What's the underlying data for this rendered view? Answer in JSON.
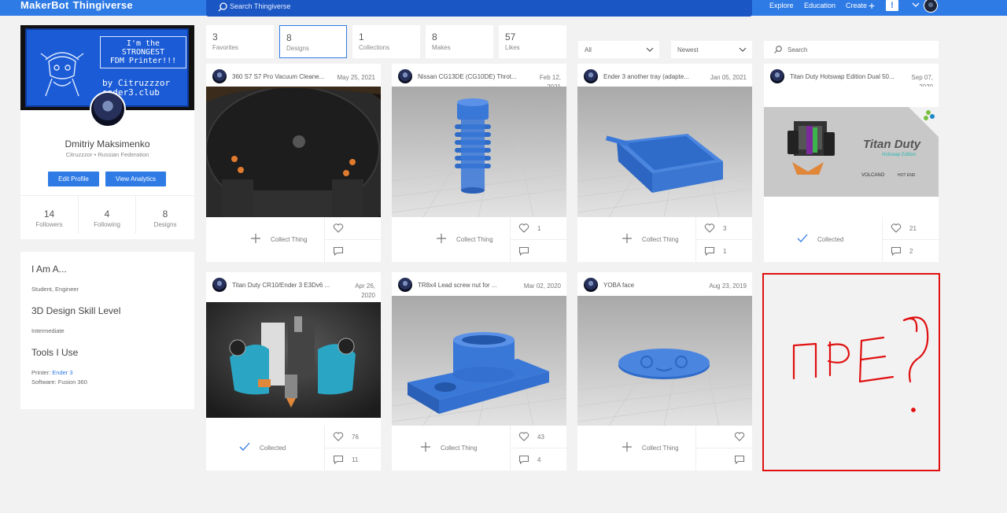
{
  "header": {
    "logo_part1": "MakerBot",
    "logo_part2": "Thingiverse",
    "search_placeholder": "Search Thingiverse",
    "nav": {
      "explore": "Explore",
      "education": "Education",
      "create": "Create",
      "alert": "!"
    }
  },
  "profile": {
    "cover_text": "I'm the\nSTRONGEST\nFDM Printer!!!",
    "cover_text2": "by Citruzzzor\nender3.club",
    "name": "Dmitriy Maksimenko",
    "subtitle": "Citruzzzor • Russian Federation",
    "edit_label": "Edit Profile",
    "analytics_label": "View Analytics",
    "stats": [
      {
        "n": "14",
        "l": "Followers"
      },
      {
        "n": "4",
        "l": "Following"
      },
      {
        "n": "8",
        "l": "Designs"
      }
    ]
  },
  "about": {
    "h1": "I Am A...",
    "t1": "Student,  Engineer",
    "h2": "3D Design Skill Level",
    "t2": "Intermediate",
    "h3": "Tools I Use",
    "printer_label": "Printer:",
    "printer_value": "Ender 3",
    "software": "Software: Fusion 360"
  },
  "tabs": [
    {
      "n": "3",
      "l": "Favorites"
    },
    {
      "n": "8",
      "l": "Designs"
    },
    {
      "n": "1",
      "l": "Collections"
    },
    {
      "n": "8",
      "l": "Makes"
    },
    {
      "n": "57",
      "l": "Likes"
    }
  ],
  "filters": {
    "type": "All",
    "sort": "Newest",
    "search_placeholder": "Search"
  },
  "cards": [
    {
      "title": "360 S7 S7 Pro Vacuum Cleane...",
      "date": "May 25, 2021",
      "collect": "Collect Thing",
      "likes": "",
      "comments": ""
    },
    {
      "title": "Nissan CG13DE (CG10DE) Throt...",
      "date": "Feb 12,\n2021",
      "collect": "Collect Thing",
      "likes": "1",
      "comments": ""
    },
    {
      "title": "Ender 3 another tray (adapte...",
      "date": "Jan 05, 2021",
      "collect": "Collect Thing",
      "likes": "3",
      "comments": "1"
    },
    {
      "title": "Titan Duty Hotswap Edition Dual 50...",
      "date": "Sep 07,\n2020",
      "collect": "Collected",
      "likes": "21",
      "comments": "2"
    },
    {
      "title": "Titan Duty CR10/Ender 3 E3Dv6 ...",
      "date": "Apr 26,\n2020",
      "collect": "Collected",
      "likes": "76",
      "comments": "11"
    },
    {
      "title": "TR8x4 Lead screw nut for ...",
      "date": "Mar 02, 2020",
      "collect": "Collect Thing",
      "likes": "43",
      "comments": "4"
    },
    {
      "title": "YOBA face",
      "date": "Aug 23, 2019",
      "collect": "Collect Thing",
      "likes": "",
      "comments": ""
    }
  ],
  "titan_image_text": {
    "brand": "Titan Duty",
    "sub": "Hotswap Edition",
    "logo1": "VOLCANO",
    "logo2": "HOT END"
  },
  "colors": {
    "accent": "#2f7be5",
    "annotation": "#e01010"
  }
}
